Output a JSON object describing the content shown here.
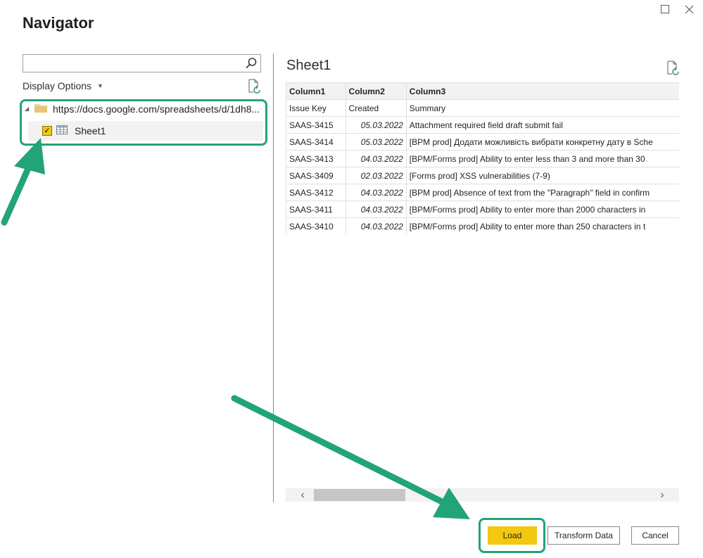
{
  "window": {
    "title": "Navigator",
    "maximize_icon": "maximize-icon",
    "close_icon": "close-icon"
  },
  "left_pane": {
    "search": {
      "value": "",
      "placeholder": ""
    },
    "display_options_label": "Display Options",
    "tree": {
      "root": {
        "label": "https://docs.google.com/spreadsheets/d/1dh8...",
        "expanded": true,
        "icon": "folder-icon"
      },
      "items": [
        {
          "label": "Sheet1",
          "checked": true,
          "icon": "table-icon"
        }
      ]
    }
  },
  "preview": {
    "title": "Sheet1",
    "columns": [
      "Column1",
      "Column2",
      "Column3"
    ],
    "rows": [
      [
        "Issue Key",
        "Created",
        "Summary"
      ],
      [
        "SAAS-3415",
        "05.03.2022",
        "Attachment required field draft submit fail"
      ],
      [
        "SAAS-3414",
        "05.03.2022",
        "[BPM prod] Додати можливість вибрати конкретну дату в Sche"
      ],
      [
        "SAAS-3413",
        "04.03.2022",
        "[BPM/Forms prod] Ability to enter less than 3 and more than 30"
      ],
      [
        "SAAS-3409",
        "02.03.2022",
        "[Forms prod] XSS vulnerabilities (7-9)"
      ],
      [
        "SAAS-3412",
        "04.03.2022",
        "[BPM prod] Absence of text from the \"Paragraph\" field in confirm"
      ],
      [
        "SAAS-3411",
        "04.03.2022",
        "[BPM/Forms prod] Ability to enter more than 2000 characters in"
      ],
      [
        "SAAS-3410",
        "04.03.2022",
        "[BPM/Forms prod] Ability to enter more than 250 characters in t"
      ]
    ]
  },
  "footer": {
    "load_label": "Load",
    "transform_label": "Transform Data",
    "cancel_label": "Cancel"
  },
  "colors": {
    "accent_yellow": "#f2c811",
    "annotation_green": "#22a37a"
  }
}
